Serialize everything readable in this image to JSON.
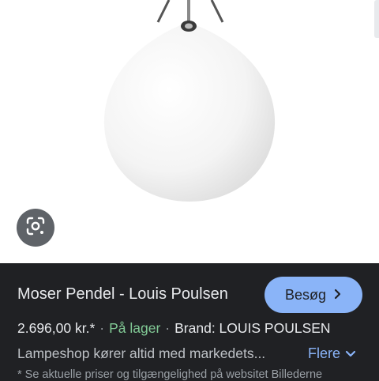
{
  "product": {
    "title": "Moser Pendel - Louis Poulsen",
    "price": "2.696,00 kr.*",
    "availability": "På lager",
    "brand": "Brand: LOUIS POULSEN",
    "description": "Lampeshop kører altid med markedets...",
    "note": "* Se aktuelle priser og tilgængelighed på websitet Billederne"
  },
  "actions": {
    "visit_label": "Besøg",
    "more_label": "Flere"
  },
  "icons": {
    "lens": "google-lens-icon",
    "visit_chevron": "chevron-right-icon",
    "more_chevron": "chevron-down-icon"
  },
  "colors": {
    "panel_bg": "#202124",
    "accent": "#8ab4f8",
    "in_stock": "#81c995",
    "text": "#e8eaed"
  }
}
